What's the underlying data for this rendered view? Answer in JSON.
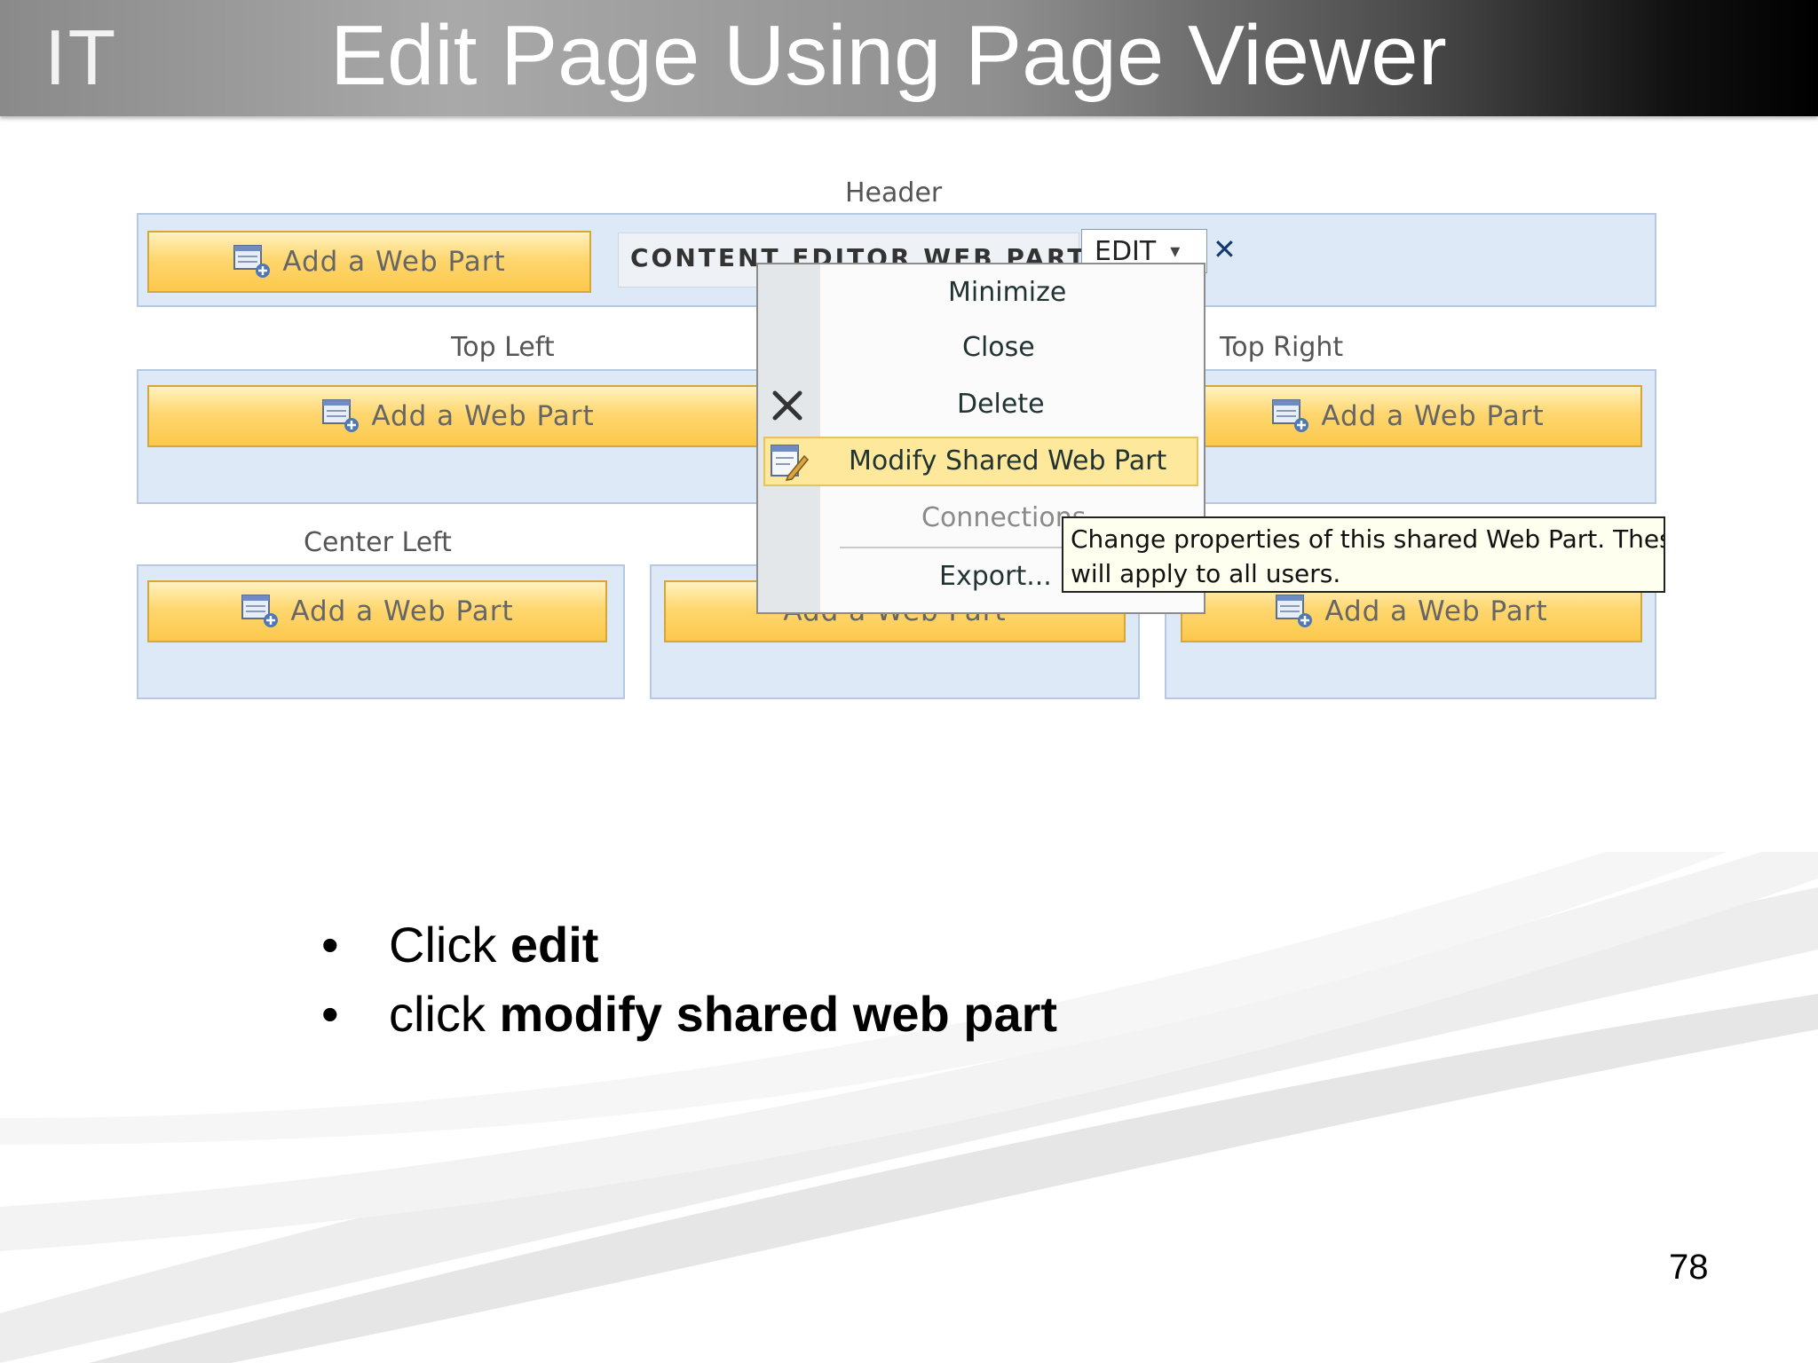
{
  "slide": {
    "logo": "IT",
    "title": "Edit Page Using Page Viewer",
    "page_number": "78"
  },
  "screenshot": {
    "zones": {
      "header": "Header",
      "top_left": "Top Left",
      "top_right": "Top Right",
      "center_left": "Center Left"
    },
    "add_web_part_label": "Add a Web Part",
    "web_part_title": "CONTENT EDITOR WEB PART",
    "edit_button_label": "EDIT",
    "edit_arrow": "▾",
    "close_glyph": "✕",
    "menu": {
      "items": [
        "Minimize",
        "Close",
        "Delete",
        "Modify Shared Web Part",
        "Connections",
        "Export..."
      ],
      "highlighted_item": "Modify Shared Web Part"
    },
    "tooltip": {
      "line1": "Change properties of this shared Web Part. These",
      "line2": "will apply to all users."
    },
    "icons": [
      "add-web-part-icon",
      "delete-x-icon",
      "modify-edit-icon"
    ]
  },
  "bullets": [
    {
      "prefix": "Click ",
      "bold": "edit"
    },
    {
      "prefix": "click ",
      "bold": "modify shared web part"
    }
  ],
  "bullet_symbol": "•",
  "colors": {
    "zone_fill": "#dde9f7",
    "button_fill": "#fbc84b",
    "highlight_fill": "#fde89b",
    "tooltip_fill": "#fffff0"
  }
}
